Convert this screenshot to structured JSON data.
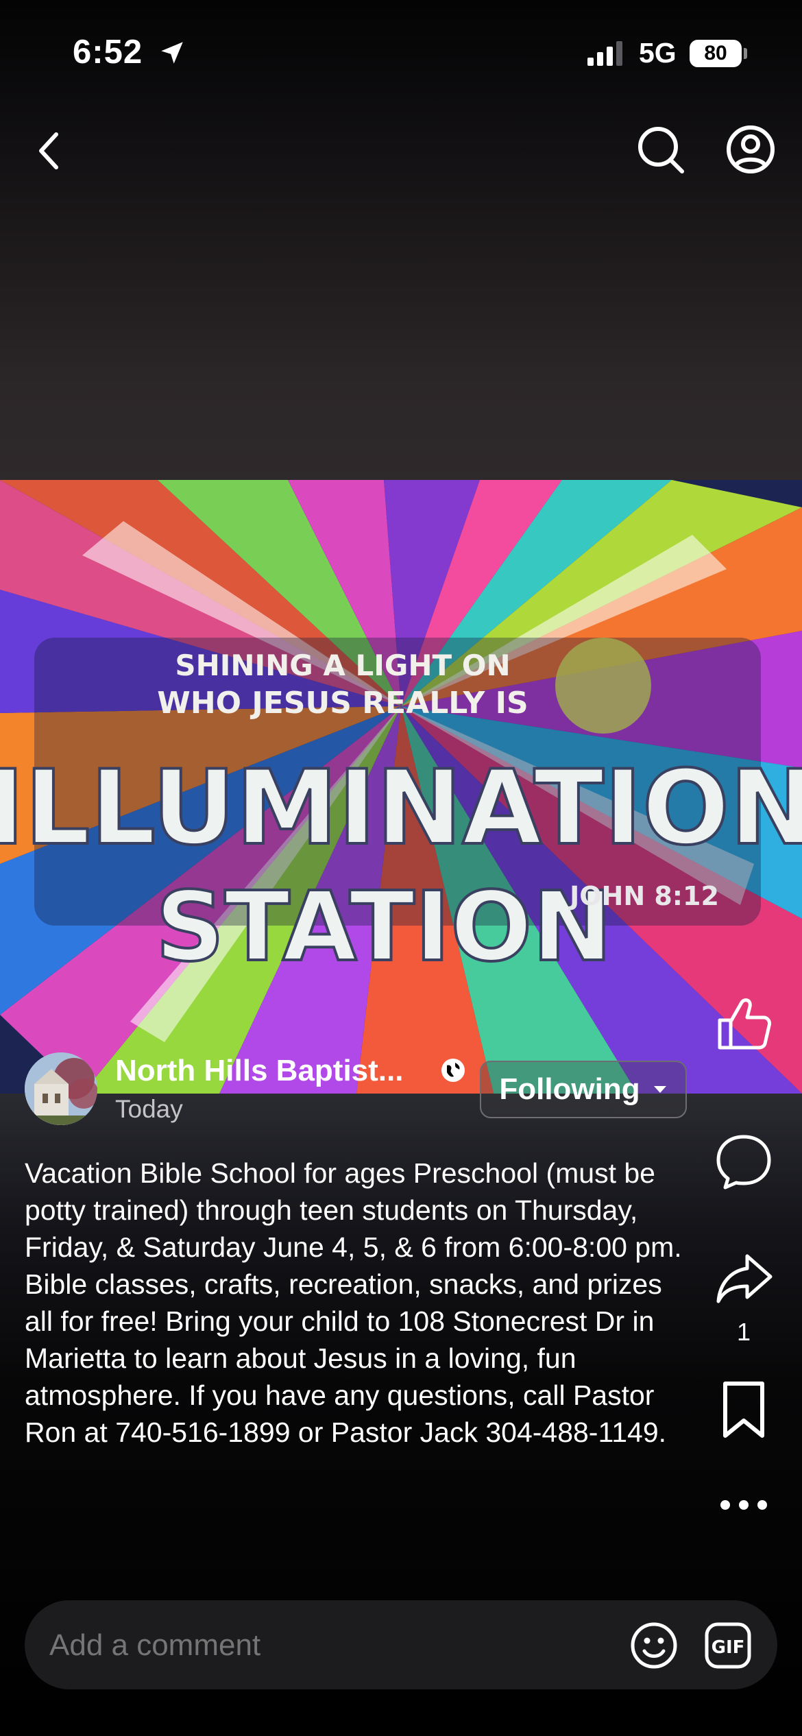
{
  "status_bar": {
    "time": "6:52",
    "network": "5G",
    "battery": "80"
  },
  "post": {
    "author": "North Hills Baptist...",
    "time": "Today",
    "follow_label": "Following",
    "image": {
      "line1": "SHINING A LIGHT ON",
      "line2": "WHO JESUS REALLY IS",
      "title1": "ILLUMINATION",
      "title2": "STATION",
      "verse": "JOHN 8:12"
    },
    "caption": "Vacation Bible School for ages Preschool (must be potty trained) through teen students on Thursday, Friday, & Saturday June 4, 5, & 6 from 6:00-8:00 pm. Bible classes, crafts, recreation, snacks, and prizes all for free! Bring your child to 108 Stonecrest Dr in Marietta to learn about Jesus in a loving, fun atmosphere. If you have any questions, call Pastor Ron at 740-516-1899 or Pastor Jack 304-488-1149.",
    "share_count": "1"
  },
  "comment_bar": {
    "placeholder": "Add a comment",
    "gif_label": "GIF"
  },
  "icons": {
    "back": "chevron-left-icon",
    "search": "search-icon",
    "profile": "profile-icon",
    "like": "thumbs-up-icon",
    "comment": "comment-icon",
    "share": "share-icon",
    "save": "bookmark-icon",
    "more": "more-icon",
    "globe": "globe-icon",
    "emoji": "emoji-icon",
    "gif": "gif-icon"
  },
  "colors": {
    "background": "#000000",
    "text": "#ffffff",
    "secondary_text": "#c4c4c6",
    "comment_bar": "#1c1c1e"
  }
}
